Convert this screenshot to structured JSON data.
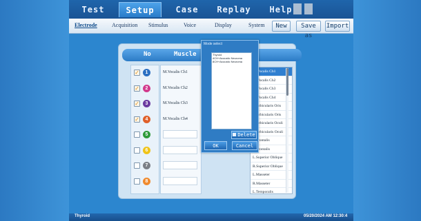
{
  "top_tabs": [
    "Test",
    "Setup",
    "Case",
    "Replay",
    "Help"
  ],
  "sub_tabs": [
    "Electrode",
    "Acquisition",
    "Stimulus",
    "Voice",
    "Display",
    "System"
  ],
  "sub_buttons": {
    "new": "New",
    "save_as": "Save as",
    "import": "Import"
  },
  "table": {
    "col_no": "No",
    "col_muscle": "Muscle",
    "rows": [
      {
        "checked": true,
        "num": "1",
        "color": "#2b6fc2",
        "name": "M.Vocalis Ch1"
      },
      {
        "checked": true,
        "num": "2",
        "color": "#d23a8c",
        "name": "M.Vocalis Ch2"
      },
      {
        "checked": true,
        "num": "3",
        "color": "#6b3aa0",
        "name": "M.Vocalis Ch3"
      },
      {
        "checked": true,
        "num": "4",
        "color": "#e0602a",
        "name": "M.Vocalis Ch4"
      },
      {
        "checked": false,
        "num": "5",
        "color": "#2f9a3a",
        "name": ""
      },
      {
        "checked": false,
        "num": "6",
        "color": "#f0c419",
        "name": ""
      },
      {
        "checked": false,
        "num": "7",
        "color": "#7b7f86",
        "name": ""
      },
      {
        "checked": false,
        "num": "8",
        "color": "#f08a2e",
        "name": ""
      }
    ]
  },
  "muscle_list": [
    "M.Vocalis Ch1",
    "M.Vocalis Ch2",
    "M.Vocalis Ch3",
    "M.Vocalis Ch4",
    "L.Orbicularis Oris",
    "R.Orbicularis Oris",
    "L.Orbicularis Oculi",
    "R.Orbicularis Oculi",
    "L.Frontalis",
    "R.Frontalis",
    "L.Superior Oblique",
    "R.Superior Oblique",
    "L.Masseter",
    "R.Masseter",
    "L.Temporalis"
  ],
  "dialog": {
    "title": "Mode select",
    "items": [
      "Thyroid",
      "4CH+Acoustic Neuroma",
      "8CH+Acoustic Neuroma"
    ],
    "delete_label": "Delete",
    "ok_label": "OK",
    "cancel_label": "Cancel"
  },
  "status": {
    "mode": "Thyroid",
    "datetime": "05/20/2024 AM 12:30:4"
  }
}
